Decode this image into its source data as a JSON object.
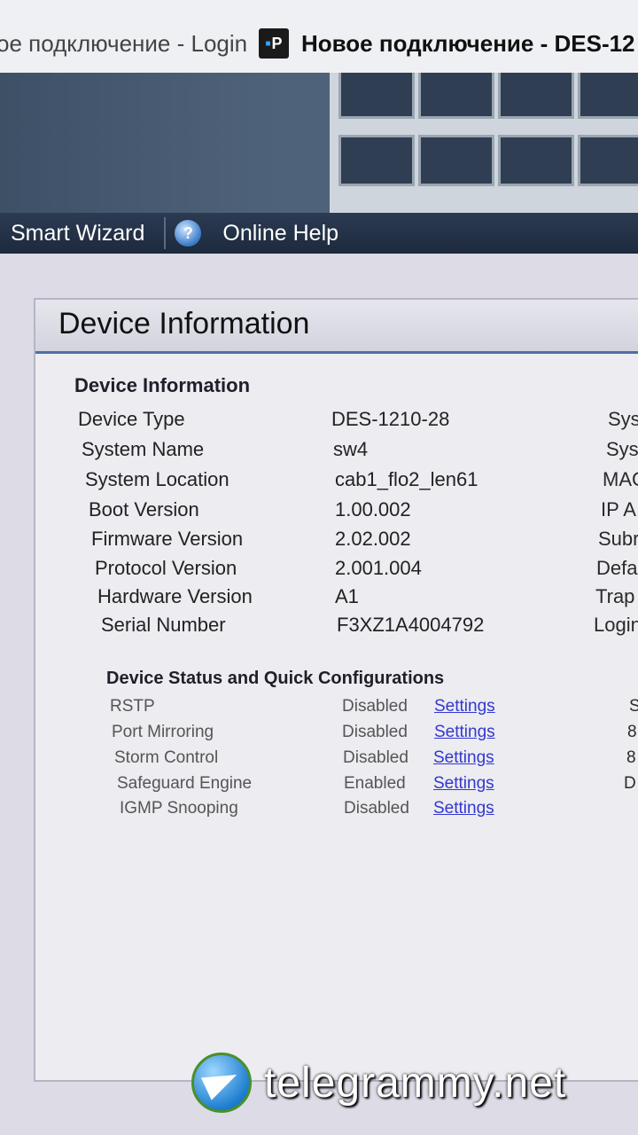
{
  "tabs": {
    "inactive_label": "ое подключение - Login",
    "active_label": "Новое подключение - DES-12",
    "active_favicon": "P"
  },
  "menu": {
    "items": [
      {
        "label": "Smart Wizard"
      },
      {
        "label": "Online Help",
        "icon": "help-icon"
      }
    ]
  },
  "panel": {
    "title": "Device Information"
  },
  "device_info": {
    "section_title": "Device Information",
    "rows": [
      {
        "label": "Device Type",
        "value": "DES-1210-28",
        "right_edge": "Sys"
      },
      {
        "label": "System Name",
        "value": "sw4",
        "right_edge": "Sys"
      },
      {
        "label": "System Location",
        "value": "cab1_flo2_len61",
        "right_edge": "MAC"
      },
      {
        "label": "Boot Version",
        "value": "1.00.002",
        "right_edge": "IP A"
      },
      {
        "label": "Firmware Version",
        "value": "2.02.002",
        "right_edge": "Subr"
      },
      {
        "label": "Protocol Version",
        "value": "2.001.004",
        "right_edge": "Defa"
      },
      {
        "label": "Hardware Version",
        "value": "A1",
        "right_edge": "Trap"
      },
      {
        "label": "Serial Number",
        "value": "F3XZ1A4004792",
        "right_edge": "Login"
      }
    ]
  },
  "status": {
    "section_title": "Device Status and Quick Configurations",
    "rows": [
      {
        "label": "RSTP",
        "value": "Disabled",
        "link": "Settings",
        "right_edge": "S"
      },
      {
        "label": "Port Mirroring",
        "value": "Disabled",
        "link": "Settings",
        "right_edge": "8"
      },
      {
        "label": "Storm Control",
        "value": "Disabled",
        "link": "Settings",
        "right_edge": "8"
      },
      {
        "label": "Safeguard Engine",
        "value": "Enabled",
        "link": "Settings",
        "right_edge": "D"
      },
      {
        "label": "IGMP Snooping",
        "value": "Disabled",
        "link": "Settings",
        "right_edge": ""
      }
    ]
  },
  "watermark": {
    "text": "telegrammy.net",
    "icon": "telegram-icon"
  }
}
